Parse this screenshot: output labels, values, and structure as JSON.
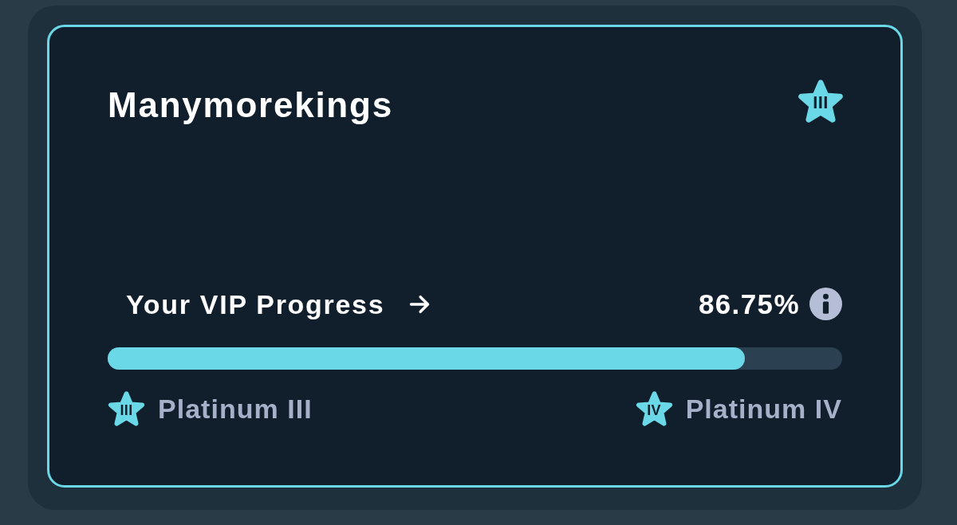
{
  "card": {
    "title": "Manymorekings",
    "tier_badge": "III",
    "progress": {
      "label": "Your VIP Progress",
      "percent": "86.75%",
      "level": 0.8675
    },
    "current_tier": {
      "badge": "III",
      "name": "Platinum III"
    },
    "next_tier": {
      "badge": "IV",
      "name": "Platinum IV"
    }
  }
}
